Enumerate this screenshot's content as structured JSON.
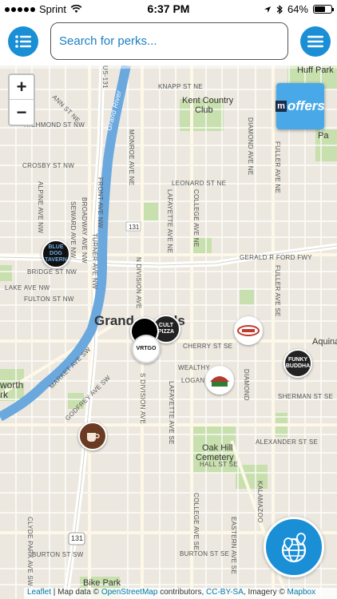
{
  "status_bar": {
    "carrier": "Sprint",
    "time": "6:37 PM",
    "battery": "64%",
    "battery_level": 0.64
  },
  "search": {
    "placeholder": "Search for perks..."
  },
  "zoom": {
    "plus": "+",
    "minus": "−"
  },
  "offers_badge": {
    "m": "m",
    "label": "offers"
  },
  "map_labels": {
    "city": "Grand Rapids",
    "city_part1": "Grand",
    "city_part2": "ds",
    "huff_park": "Huff Park",
    "kent_country_club_1": "Kent Country",
    "kent_country_club_2": "Club",
    "ball_park_1": "Ball Pa",
    "ball_park_2": "Pa",
    "oak_hill_1": "Oak Hill",
    "oak_hill_2": "Cemetery",
    "aquina": "Aquina",
    "worth_1": "worth",
    "worth_2": "rk",
    "bike_park": "Bike Park",
    "route_131": "131",
    "route_131b": "131"
  },
  "streets": {
    "knapp": "KNAPP ST NE",
    "leonard": "LEONARD ST NE",
    "crosby": "CROSBY ST NW",
    "richmond": "RICHMOND ST NW",
    "ann": "ANN ST NE",
    "bridge": "BRIDGE ST NW",
    "lake": "LAKE AVE NW",
    "fulton": "FULTON ST NW",
    "cherry": "CHERRY ST SE",
    "wealthy": "WEALTHY",
    "logan": "LOGAN ST SE",
    "sherman": "SHERMAN ST SE",
    "alexander": "ALEXANDER ST SE",
    "hall": "HALL ST SE",
    "burton": "BURTON ST SE",
    "burton_sw": "BURTON ST SW",
    "market": "MARKET AVE SW",
    "godfrey": "GODFREY AVE SW",
    "gerald": "GERALD R FORD FWY",
    "grand_river": "Grand River",
    "monroe": "MONROE AVE NE",
    "college": "COLLEGE AVE NE",
    "lafayette": "LAFAYETTE AVE NE",
    "diamond": "DIAMOND AVE NE",
    "fuller": "FULLER AVE NE",
    "fuller_se": "FULLER AVE SE",
    "front": "FRONT AVE NW",
    "broadway": "BROADWAY AVE NW",
    "seward": "SEWARD AVE NW",
    "alpine": "ALPINE AVE NW",
    "turner": "TURNER AVE NW",
    "division": "S DIVISION AVE",
    "division_n": "N DIVISION AVE",
    "lafayette_se": "LAFAYETTE AVE SE",
    "college_se": "COLLEGE AVE SE",
    "eastern": "EASTERN AVE SE",
    "kalamazoo": "KALAMAZOO",
    "clyde": "CLYDE PARK AVE SW",
    "us131": "US-131",
    "diamond_se": "DIAMOND"
  },
  "markers": [
    {
      "name": "blue-dog-tavern",
      "text": "BLUE DOG TAVERN",
      "bg": "#111111",
      "fg": "#6fa8dc"
    },
    {
      "name": "cult-pizza",
      "text": "CULT PIZZA",
      "bg": "#222222",
      "fg": "#ffffff"
    },
    {
      "name": "black-circle-marker",
      "text": "",
      "bg": "#000000",
      "fg": "#ffffff"
    },
    {
      "name": "vertigo",
      "text": "VRTGO",
      "bg": "#ffffff",
      "fg": "#111111"
    },
    {
      "name": "funky-buddha",
      "text": "FUNKY BUDDHA",
      "bg": "#222222",
      "fg": "#ffffff"
    },
    {
      "name": "diner-red",
      "text": "",
      "bg": "#ffffff",
      "fg": "#c0392b"
    },
    {
      "name": "mexican-restaurant",
      "text": "",
      "bg": "#ffffff",
      "fg": "#b03a2e"
    },
    {
      "name": "coffee-shop",
      "text": "",
      "bg": "#6b3a22",
      "fg": "#ffffff"
    }
  ],
  "attribution": {
    "leaflet": "Leaflet",
    "map_data": " | Map data © ",
    "osm": "OpenStreetMap",
    "contributors": " contributors, ",
    "ccbysa": "CC-BY-SA",
    "imagery": ", Imagery © ",
    "mapbox": "Mapbox"
  },
  "colors": {
    "accent": "#1a8fd6",
    "map_bg": "#ece8df",
    "park": "#c8dfae",
    "river": "#6aa8de",
    "highway": "#ffffff"
  }
}
